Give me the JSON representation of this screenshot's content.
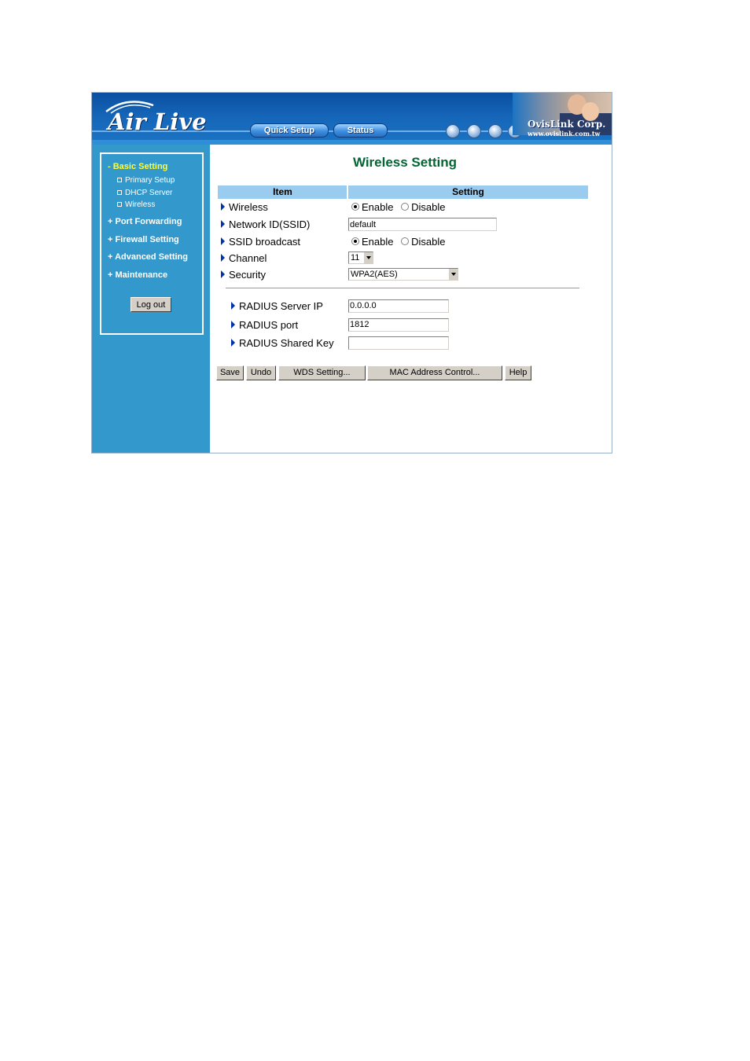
{
  "header": {
    "brand": "Air Live",
    "nav": [
      "Quick Setup",
      "Status"
    ],
    "corp_name": "OvisLink Corp.",
    "corp_url": "www.ovislink.com.tw"
  },
  "sidebar": {
    "basic_setting": "- Basic Setting",
    "sub_items": [
      "Primary Setup",
      "DHCP Server",
      "Wireless"
    ],
    "port_forwarding": "+ Port Forwarding",
    "firewall_setting": "+ Firewall Setting",
    "advanced_setting": "+ Advanced Setting",
    "maintenance": "+ Maintenance",
    "logout": "Log out"
  },
  "main": {
    "title": "Wireless Setting",
    "col_item": "Item",
    "col_setting": "Setting",
    "wireless": {
      "label": "Wireless",
      "enable": "Enable",
      "disable": "Disable",
      "selected": "Enable"
    },
    "ssid": {
      "label": "Network ID(SSID)",
      "value": "default"
    },
    "ssid_broadcast": {
      "label": "SSID broadcast",
      "enable": "Enable",
      "disable": "Disable",
      "selected": "Enable"
    },
    "channel": {
      "label": "Channel",
      "value": "11"
    },
    "security": {
      "label": "Security",
      "value": "WPA2(AES)"
    },
    "radius_ip": {
      "label": "RADIUS Server IP",
      "value": "0.0.0.0"
    },
    "radius_port": {
      "label": "RADIUS port",
      "value": "1812"
    },
    "radius_key": {
      "label": "RADIUS Shared Key",
      "value": ""
    }
  },
  "buttons": {
    "save": "Save",
    "undo": "Undo",
    "wds": "WDS Setting...",
    "mac": "MAC Address Control...",
    "help": "Help"
  },
  "colors": {
    "header_blue": "#1565b8",
    "sidebar_blue": "#3399cc",
    "active_menu": "#ffff33",
    "title_green": "#006633",
    "table_header": "#99ccee"
  }
}
